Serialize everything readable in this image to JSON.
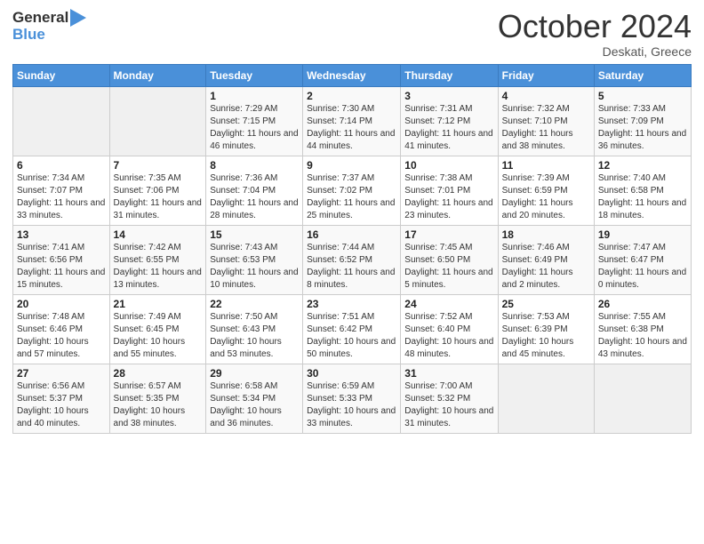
{
  "header": {
    "logo": {
      "line1": "General",
      "line2": "Blue"
    },
    "title": "October 2024",
    "location": "Deskati, Greece"
  },
  "weekdays": [
    "Sunday",
    "Monday",
    "Tuesday",
    "Wednesday",
    "Thursday",
    "Friday",
    "Saturday"
  ],
  "weeks": [
    [
      {
        "day": "",
        "sunrise": "",
        "sunset": "",
        "daylight": ""
      },
      {
        "day": "",
        "sunrise": "",
        "sunset": "",
        "daylight": ""
      },
      {
        "day": "1",
        "sunrise": "Sunrise: 7:29 AM",
        "sunset": "Sunset: 7:15 PM",
        "daylight": "Daylight: 11 hours and 46 minutes."
      },
      {
        "day": "2",
        "sunrise": "Sunrise: 7:30 AM",
        "sunset": "Sunset: 7:14 PM",
        "daylight": "Daylight: 11 hours and 44 minutes."
      },
      {
        "day": "3",
        "sunrise": "Sunrise: 7:31 AM",
        "sunset": "Sunset: 7:12 PM",
        "daylight": "Daylight: 11 hours and 41 minutes."
      },
      {
        "day": "4",
        "sunrise": "Sunrise: 7:32 AM",
        "sunset": "Sunset: 7:10 PM",
        "daylight": "Daylight: 11 hours and 38 minutes."
      },
      {
        "day": "5",
        "sunrise": "Sunrise: 7:33 AM",
        "sunset": "Sunset: 7:09 PM",
        "daylight": "Daylight: 11 hours and 36 minutes."
      }
    ],
    [
      {
        "day": "6",
        "sunrise": "Sunrise: 7:34 AM",
        "sunset": "Sunset: 7:07 PM",
        "daylight": "Daylight: 11 hours and 33 minutes."
      },
      {
        "day": "7",
        "sunrise": "Sunrise: 7:35 AM",
        "sunset": "Sunset: 7:06 PM",
        "daylight": "Daylight: 11 hours and 31 minutes."
      },
      {
        "day": "8",
        "sunrise": "Sunrise: 7:36 AM",
        "sunset": "Sunset: 7:04 PM",
        "daylight": "Daylight: 11 hours and 28 minutes."
      },
      {
        "day": "9",
        "sunrise": "Sunrise: 7:37 AM",
        "sunset": "Sunset: 7:02 PM",
        "daylight": "Daylight: 11 hours and 25 minutes."
      },
      {
        "day": "10",
        "sunrise": "Sunrise: 7:38 AM",
        "sunset": "Sunset: 7:01 PM",
        "daylight": "Daylight: 11 hours and 23 minutes."
      },
      {
        "day": "11",
        "sunrise": "Sunrise: 7:39 AM",
        "sunset": "Sunset: 6:59 PM",
        "daylight": "Daylight: 11 hours and 20 minutes."
      },
      {
        "day": "12",
        "sunrise": "Sunrise: 7:40 AM",
        "sunset": "Sunset: 6:58 PM",
        "daylight": "Daylight: 11 hours and 18 minutes."
      }
    ],
    [
      {
        "day": "13",
        "sunrise": "Sunrise: 7:41 AM",
        "sunset": "Sunset: 6:56 PM",
        "daylight": "Daylight: 11 hours and 15 minutes."
      },
      {
        "day": "14",
        "sunrise": "Sunrise: 7:42 AM",
        "sunset": "Sunset: 6:55 PM",
        "daylight": "Daylight: 11 hours and 13 minutes."
      },
      {
        "day": "15",
        "sunrise": "Sunrise: 7:43 AM",
        "sunset": "Sunset: 6:53 PM",
        "daylight": "Daylight: 11 hours and 10 minutes."
      },
      {
        "day": "16",
        "sunrise": "Sunrise: 7:44 AM",
        "sunset": "Sunset: 6:52 PM",
        "daylight": "Daylight: 11 hours and 8 minutes."
      },
      {
        "day": "17",
        "sunrise": "Sunrise: 7:45 AM",
        "sunset": "Sunset: 6:50 PM",
        "daylight": "Daylight: 11 hours and 5 minutes."
      },
      {
        "day": "18",
        "sunrise": "Sunrise: 7:46 AM",
        "sunset": "Sunset: 6:49 PM",
        "daylight": "Daylight: 11 hours and 2 minutes."
      },
      {
        "day": "19",
        "sunrise": "Sunrise: 7:47 AM",
        "sunset": "Sunset: 6:47 PM",
        "daylight": "Daylight: 11 hours and 0 minutes."
      }
    ],
    [
      {
        "day": "20",
        "sunrise": "Sunrise: 7:48 AM",
        "sunset": "Sunset: 6:46 PM",
        "daylight": "Daylight: 10 hours and 57 minutes."
      },
      {
        "day": "21",
        "sunrise": "Sunrise: 7:49 AM",
        "sunset": "Sunset: 6:45 PM",
        "daylight": "Daylight: 10 hours and 55 minutes."
      },
      {
        "day": "22",
        "sunrise": "Sunrise: 7:50 AM",
        "sunset": "Sunset: 6:43 PM",
        "daylight": "Daylight: 10 hours and 53 minutes."
      },
      {
        "day": "23",
        "sunrise": "Sunrise: 7:51 AM",
        "sunset": "Sunset: 6:42 PM",
        "daylight": "Daylight: 10 hours and 50 minutes."
      },
      {
        "day": "24",
        "sunrise": "Sunrise: 7:52 AM",
        "sunset": "Sunset: 6:40 PM",
        "daylight": "Daylight: 10 hours and 48 minutes."
      },
      {
        "day": "25",
        "sunrise": "Sunrise: 7:53 AM",
        "sunset": "Sunset: 6:39 PM",
        "daylight": "Daylight: 10 hours and 45 minutes."
      },
      {
        "day": "26",
        "sunrise": "Sunrise: 7:55 AM",
        "sunset": "Sunset: 6:38 PM",
        "daylight": "Daylight: 10 hours and 43 minutes."
      }
    ],
    [
      {
        "day": "27",
        "sunrise": "Sunrise: 6:56 AM",
        "sunset": "Sunset: 5:37 PM",
        "daylight": "Daylight: 10 hours and 40 minutes."
      },
      {
        "day": "28",
        "sunrise": "Sunrise: 6:57 AM",
        "sunset": "Sunset: 5:35 PM",
        "daylight": "Daylight: 10 hours and 38 minutes."
      },
      {
        "day": "29",
        "sunrise": "Sunrise: 6:58 AM",
        "sunset": "Sunset: 5:34 PM",
        "daylight": "Daylight: 10 hours and 36 minutes."
      },
      {
        "day": "30",
        "sunrise": "Sunrise: 6:59 AM",
        "sunset": "Sunset: 5:33 PM",
        "daylight": "Daylight: 10 hours and 33 minutes."
      },
      {
        "day": "31",
        "sunrise": "Sunrise: 7:00 AM",
        "sunset": "Sunset: 5:32 PM",
        "daylight": "Daylight: 10 hours and 31 minutes."
      },
      {
        "day": "",
        "sunrise": "",
        "sunset": "",
        "daylight": ""
      },
      {
        "day": "",
        "sunrise": "",
        "sunset": "",
        "daylight": ""
      }
    ]
  ]
}
